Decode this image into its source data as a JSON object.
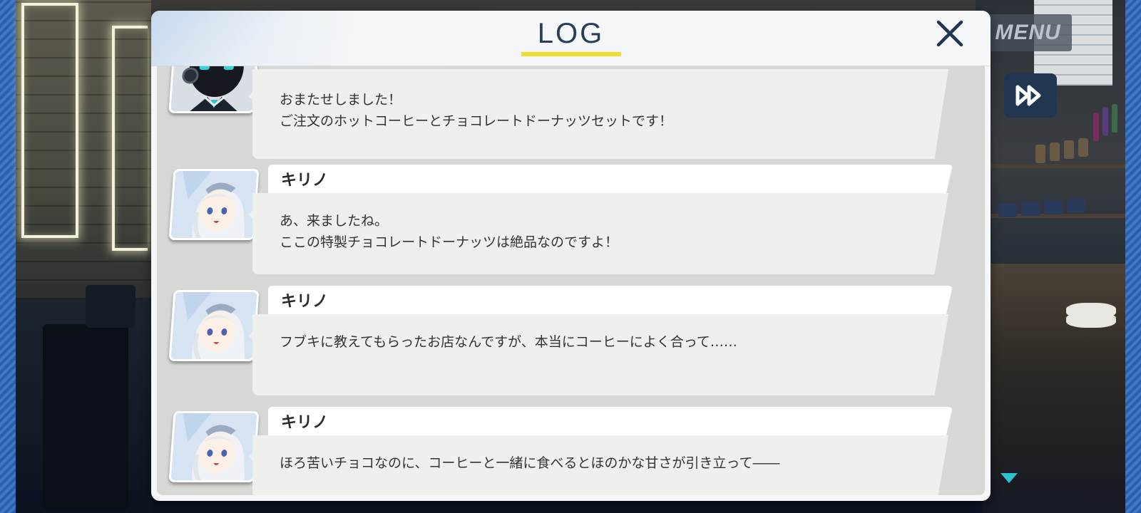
{
  "header": {
    "title": "LOG",
    "close_label": "×"
  },
  "hud": {
    "menu_label": "MENU",
    "skip_icon": "fast-forward-icon",
    "more_icon": "scroll-down-arrow-icon"
  },
  "colors": {
    "title": "#2b3c59",
    "underline": "#f2dd2c",
    "panel_bg": "#f4f6f7",
    "message_bg": "#efefed"
  },
  "log_entries": [
    {
      "speaker": "",
      "avatar": "robot-clerk-avatar",
      "message": "おまたせしました！\nご注文のホットコーヒーとチョコレートドーナッツセットです！"
    },
    {
      "speaker": "キリノ",
      "avatar": "kirino-avatar",
      "message": "あ、来ましたね。\nここの特製チョコレートドーナッツは絶品なのですよ！"
    },
    {
      "speaker": "キリノ",
      "avatar": "kirino-avatar",
      "message": "フブキに教えてもらったお店なんですが、本当にコーヒーによく合って……"
    },
    {
      "speaker": "キリノ",
      "avatar": "kirino-avatar",
      "message": "ほろ苦いチョコなのに、コーヒーと一緒に食べるとほのかな甘さが引き立って――"
    }
  ]
}
